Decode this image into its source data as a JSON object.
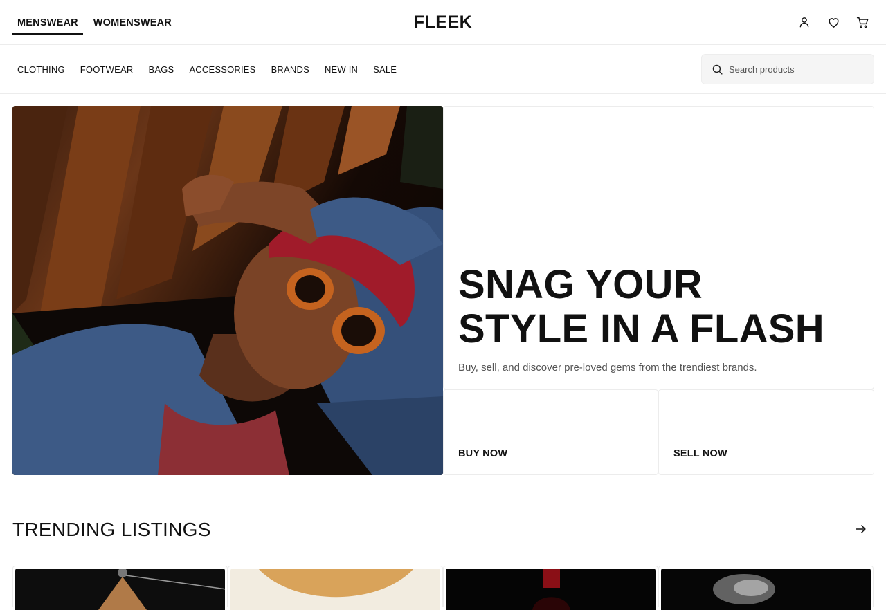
{
  "header": {
    "gender_tabs": [
      {
        "label": "MENSWEAR",
        "active": true
      },
      {
        "label": "WOMENSWEAR",
        "active": false
      }
    ],
    "logo": "FLEEK",
    "icons": [
      "user-icon",
      "heart-icon",
      "cart-icon"
    ]
  },
  "nav": {
    "categories": [
      "CLOTHING",
      "FOOTWEAR",
      "BAGS",
      "ACCESSORIES",
      "BRANDS",
      "NEW IN",
      "SALE"
    ],
    "search": {
      "placeholder": "Search products",
      "value": ""
    }
  },
  "hero": {
    "title_line1": "SNAG YOUR",
    "title_line2": "STYLE IN A FLASH",
    "subtitle": "Buy, sell, and discover pre-loved gems from the trendiest brands.",
    "buy_label": "BUY NOW",
    "sell_label": "SELL NOW"
  },
  "trending": {
    "title": "TRENDING LISTINGS",
    "arrow_icon": "arrow-right-icon"
  },
  "colors": {
    "text": "#111111",
    "muted": "#555555",
    "border": "#ececec",
    "search_bg": "#f5f5f5"
  }
}
